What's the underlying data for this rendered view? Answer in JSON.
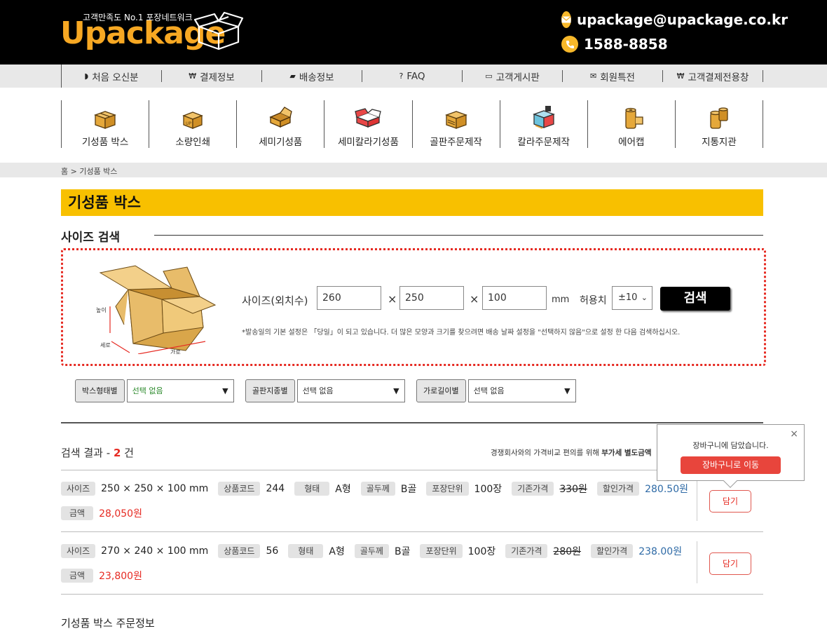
{
  "header": {
    "logo_text": "Upackage",
    "logo_tagline": "고객만족도 No.1 포장네트워크",
    "email": "upackage@upackage.co.kr",
    "phone": "1588-8858",
    "accent_color": "#f7a823"
  },
  "info_nav": [
    {
      "label": "처음 오신분",
      "icon": "shield-icon"
    },
    {
      "label": "결제정보",
      "icon": "won-icon"
    },
    {
      "label": "배송정보",
      "icon": "truck-icon"
    },
    {
      "label": "FAQ",
      "icon": "question-icon"
    },
    {
      "label": "고객게시판",
      "icon": "chat-icon"
    },
    {
      "label": "회원특전",
      "icon": "mail-icon"
    },
    {
      "label": "고객결제전용창",
      "icon": "won-icon"
    }
  ],
  "category_nav": [
    {
      "label": "기성품 박스",
      "icon": "box-icon"
    },
    {
      "label": "소량인쇄",
      "icon": "printed-box-icon"
    },
    {
      "label": "세미기성품",
      "icon": "open-box-icon"
    },
    {
      "label": "세미칼라기성품",
      "icon": "color-box-icon"
    },
    {
      "label": "골판주문제작",
      "icon": "custom-box-icon"
    },
    {
      "label": "칼라주문제작",
      "icon": "color-print-box-icon"
    },
    {
      "label": "에어캡",
      "icon": "air-cap-roll-icon"
    },
    {
      "label": "지통지관",
      "icon": "paper-tube-icon"
    }
  ],
  "breadcrumb": "홈 > 기성품 박스",
  "page_title": "기성품 박스",
  "size_search": {
    "section_title": "사이즈 검색",
    "size_label": "사이즈(외치수)",
    "width": "260",
    "depth": "250",
    "height": "100",
    "times": "×",
    "unit": "mm",
    "tolerance_label": "허용치",
    "tolerance_value": "±10",
    "search_button": "검색",
    "illustration_labels": {
      "height": "높이",
      "depth": "세로",
      "width": "가로"
    },
    "notice": "*발송일의 기본 설정은 「당일」이 되고 있습니다. 더 많은 모양과 크기를 찾으려면 배송 날짜 설정을 \"선택하지 않음\"으로 설정 한 다음 검색하십시오."
  },
  "filters": [
    {
      "label": "박스형태별",
      "value": "선택 없음",
      "highlight": true
    },
    {
      "label": "골판지종별",
      "value": "선택 없음",
      "highlight": false
    },
    {
      "label": "가로길이별",
      "value": "선택 없음",
      "highlight": false
    }
  ],
  "results": {
    "title_prefix": "검색 결과",
    "dash": "-",
    "count": "2",
    "count_unit": "건",
    "note_prefix": "경쟁회사와의 가격비교 편의를 위해",
    "note_bold": "부가세 별도금액",
    "rows": [
      {
        "size_tag": "사이즈",
        "size": "250 × 250 × 100 mm",
        "code_tag": "상품코드",
        "code": "244",
        "type_tag": "형태",
        "type": "A형",
        "thickness_tag": "골두께",
        "thickness": "B골",
        "unit_tag": "포장단위",
        "unit": "100장",
        "old_price_tag": "기존가격",
        "old_price": "330원",
        "sale_price_tag": "할인가격",
        "sale_price": "280.50원",
        "amount_tag": "금액",
        "amount": "28,050원",
        "add_button": "담기"
      },
      {
        "size_tag": "사이즈",
        "size": "270 × 240 × 100 mm",
        "code_tag": "상품코드",
        "code": "56",
        "type_tag": "형태",
        "type": "A형",
        "thickness_tag": "골두께",
        "thickness": "B골",
        "unit_tag": "포장단위",
        "unit": "100장",
        "old_price_tag": "기존가격",
        "old_price": "280원",
        "sale_price_tag": "할인가격",
        "sale_price": "238.00원",
        "amount_tag": "금액",
        "amount": "23,800원",
        "add_button": "담기"
      }
    ]
  },
  "cart_popup": {
    "message": "장바구니에 담았습니다.",
    "button": "장바구니로 이동",
    "close": "×"
  },
  "order_info_title": "기성품 박스 주문정보"
}
